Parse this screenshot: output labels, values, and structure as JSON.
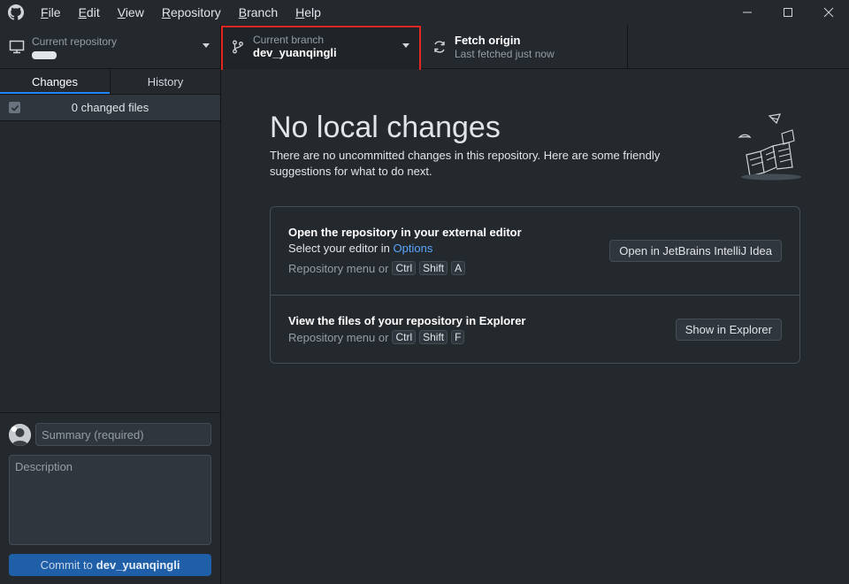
{
  "menu": {
    "items": [
      {
        "label": "File",
        "accel": "F",
        "rest": "ile"
      },
      {
        "label": "Edit",
        "accel": "E",
        "rest": "dit"
      },
      {
        "label": "View",
        "accel": "V",
        "rest": "iew"
      },
      {
        "label": "Repository",
        "accel": "R",
        "rest": "epository"
      },
      {
        "label": "Branch",
        "accel": "B",
        "rest": "ranch"
      },
      {
        "label": "Help",
        "accel": "H",
        "rest": "elp"
      }
    ]
  },
  "toolbar": {
    "repo_label": "Current repository",
    "branch_label": "Current branch",
    "branch_name": "dev_yuanqingli",
    "fetch_label": "Fetch origin",
    "fetch_status": "Last fetched just now"
  },
  "sidebar": {
    "tabs": [
      {
        "label": "Changes"
      },
      {
        "label": "History"
      }
    ],
    "changed_files": "0 changed files"
  },
  "commit": {
    "summary_placeholder": "Summary (required)",
    "description_placeholder": "Description",
    "button_prefix": "Commit to",
    "button_branch": "dev_yuanqingli"
  },
  "main": {
    "title": "No local changes",
    "subtitle": "There are no uncommitted changes in this repository. Here are some friendly suggestions for what to do next.",
    "editor_action": {
      "title": "Open the repository in your external editor",
      "desc_prefix": "Select your editor in",
      "desc_link": "Options",
      "shortcut_prefix": "Repository menu or",
      "keys": [
        "Ctrl",
        "Shift",
        "A"
      ],
      "button": "Open in JetBrains IntelliJ Idea"
    },
    "explorer_action": {
      "title": "View the files of your repository in Explorer",
      "shortcut_prefix": "Repository menu or",
      "keys": [
        "Ctrl",
        "Shift",
        "F"
      ],
      "button": "Show in Explorer"
    }
  },
  "colors": {
    "background": "#24292e",
    "accent": "#2188ff",
    "highlight": "#e3261f",
    "commit_button": "#1e5fa8"
  }
}
